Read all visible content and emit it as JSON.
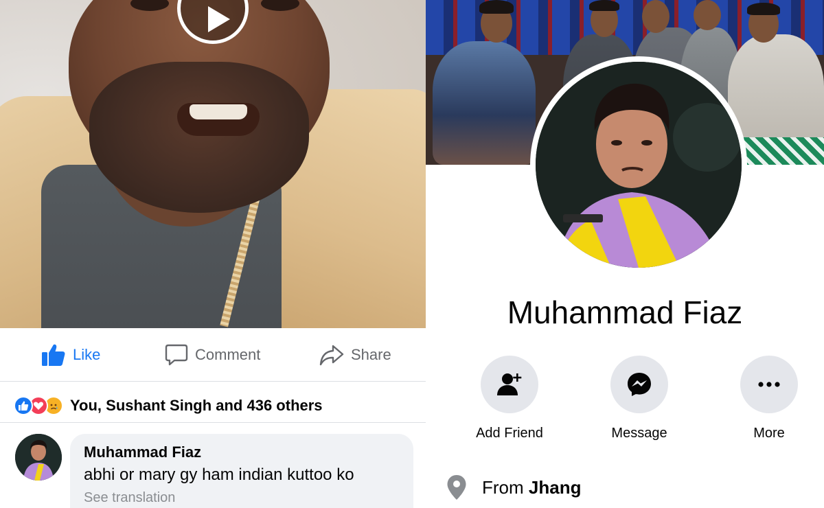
{
  "post": {
    "actions": {
      "like_label": "Like",
      "comment_label": "Comment",
      "share_label": "Share"
    },
    "reactions": {
      "icons": [
        "like-reaction-icon",
        "love-reaction-icon",
        "sad-reaction-icon"
      ],
      "summary": "You, Sushant Singh and 436 others"
    },
    "comment": {
      "author": "Muhammad Fiaz",
      "text": "abhi or mary gy ham indian kuttoo ko",
      "translate_label": "See translation"
    }
  },
  "profile": {
    "name": "Muhammad Fiaz",
    "buttons": {
      "add_friend": "Add Friend",
      "message": "Message",
      "more": "More"
    },
    "from_prefix": "From ",
    "from_place": "Jhang"
  },
  "colors": {
    "accent_blue": "#1877f2",
    "icon_gray": "#65676b",
    "button_bg": "#e4e6eb",
    "bubble_bg": "#f0f2f5"
  }
}
